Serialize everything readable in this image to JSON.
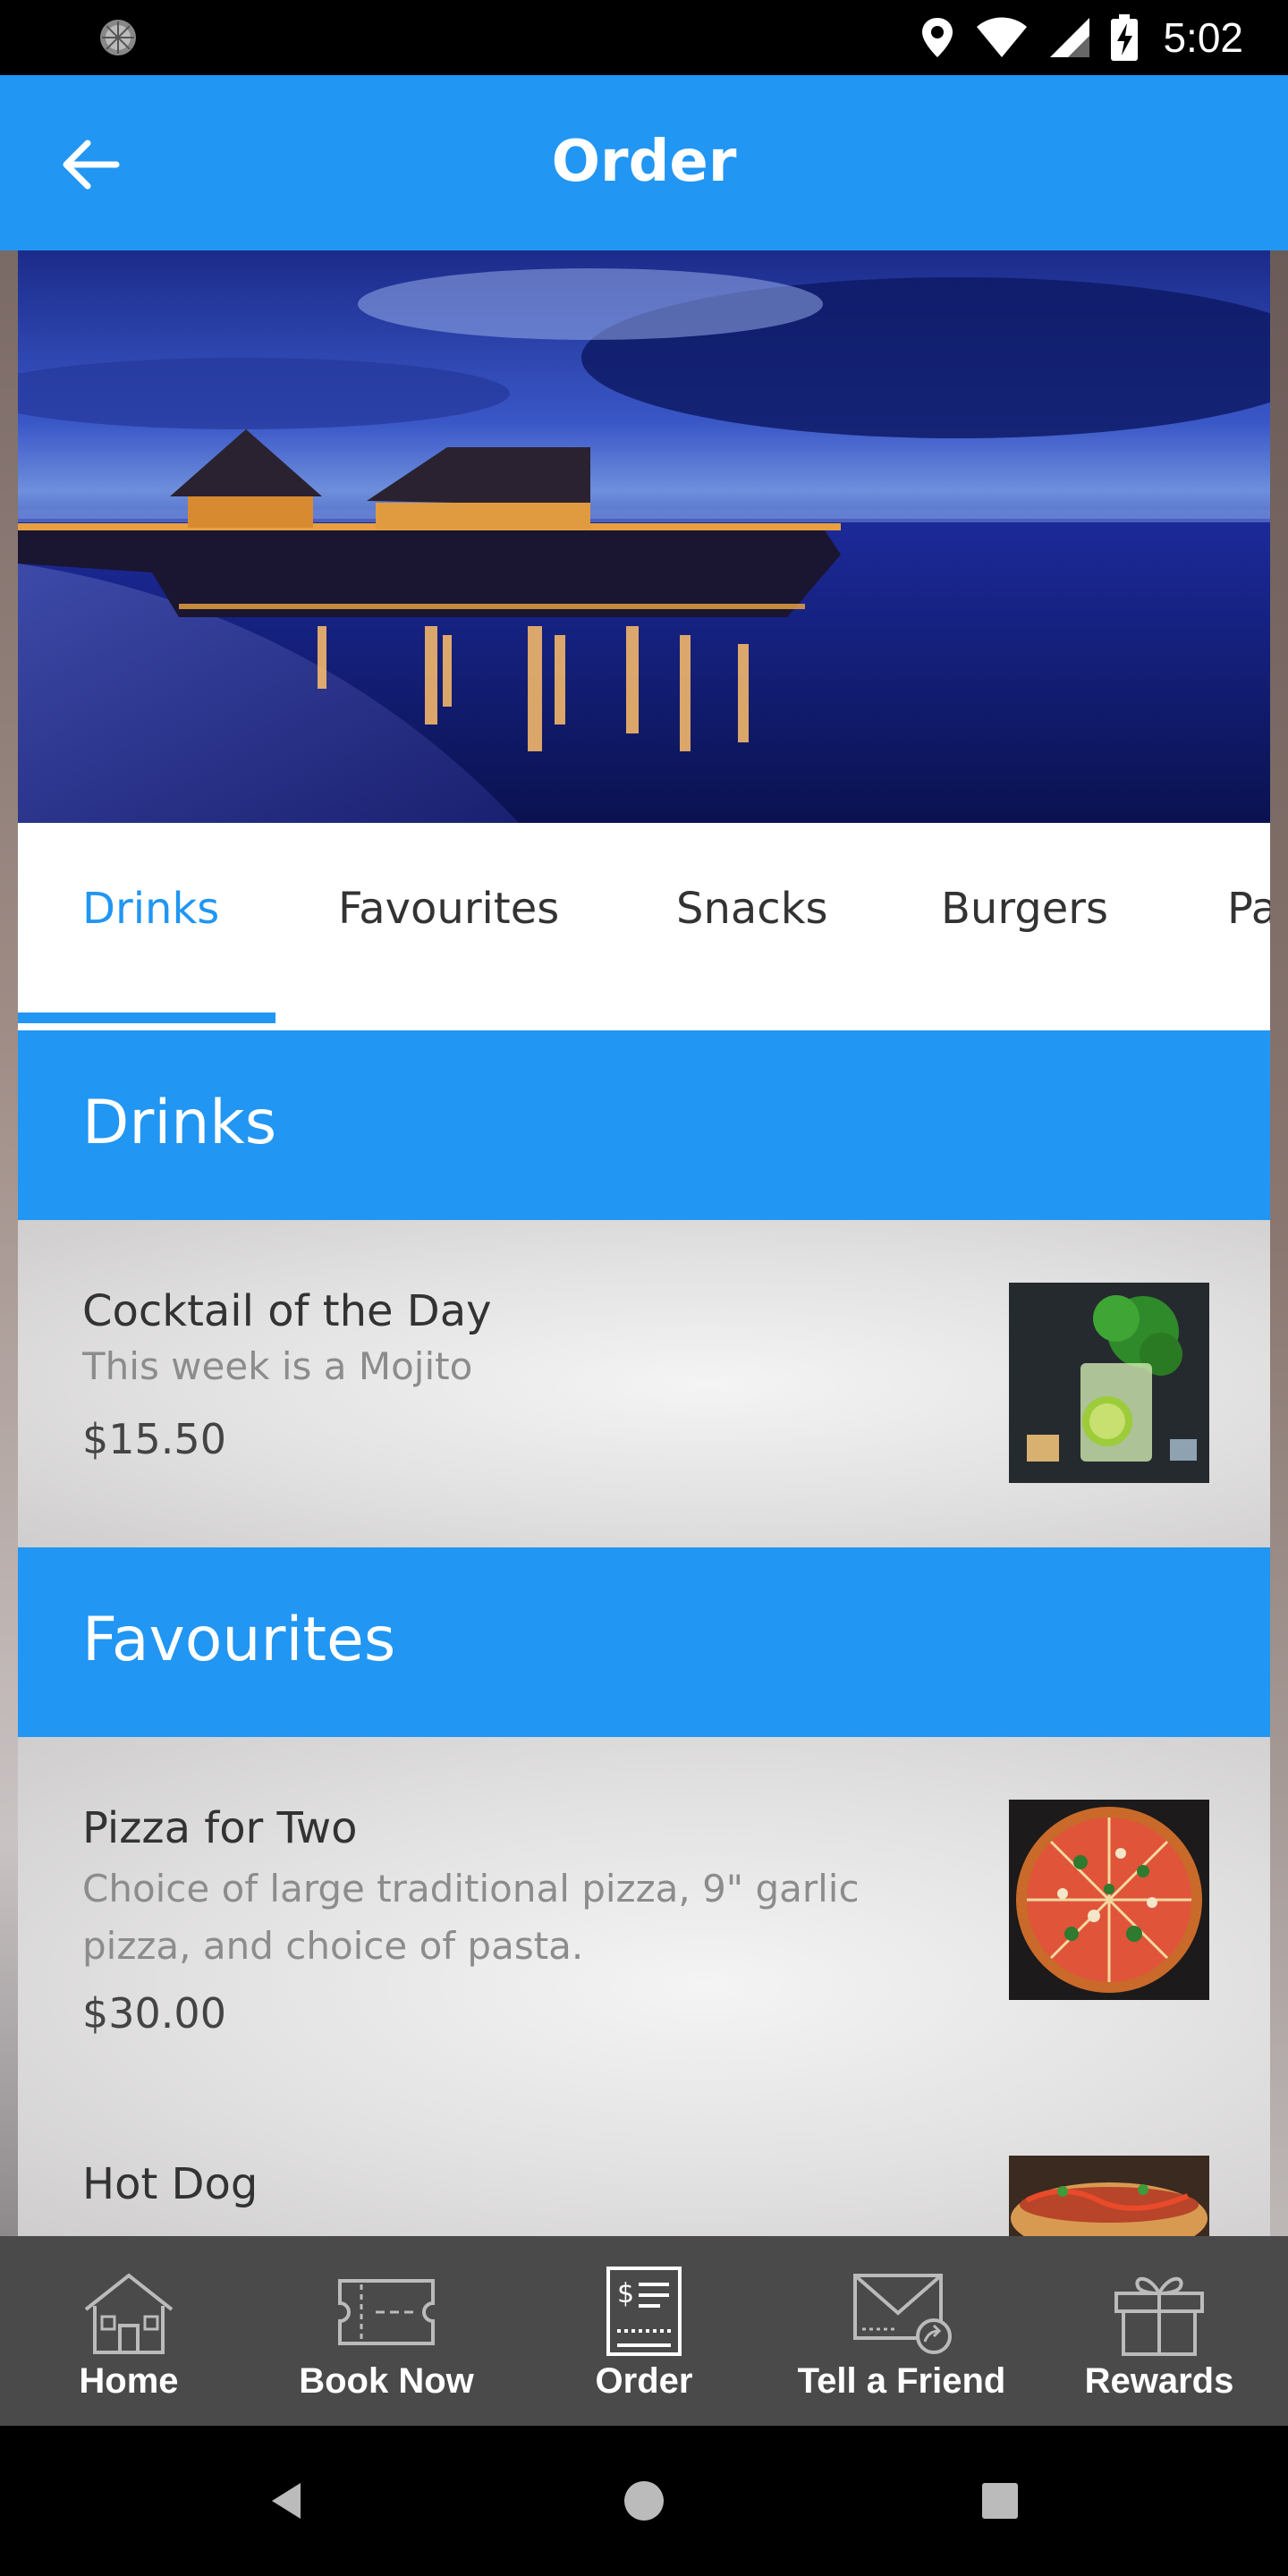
{
  "status_bar": {
    "time": "5:02"
  },
  "app_bar": {
    "title": "Order",
    "back_icon": "arrow-left-icon"
  },
  "tabs": [
    {
      "label": "Drinks",
      "active": true
    },
    {
      "label": "Favourites",
      "active": false
    },
    {
      "label": "Snacks",
      "active": false
    },
    {
      "label": "Burgers",
      "active": false
    },
    {
      "label": "Pa",
      "active": false
    }
  ],
  "sections": [
    {
      "title": "Drinks",
      "items": [
        {
          "name": "Cocktail of the Day",
          "description": "This week is a Mojito",
          "price": "$15.50",
          "image": "mojito-photo"
        }
      ]
    },
    {
      "title": "Favourites",
      "items": [
        {
          "name": "Pizza for Two",
          "description": "Choice of large traditional pizza, 9\" garlic pizza, and choice of pasta.",
          "price": "$30.00",
          "image": "pizza-photo"
        },
        {
          "name": "Hot Dog",
          "description": "",
          "price": "",
          "image": "hot-dog-photo"
        }
      ]
    }
  ],
  "bottom_nav": [
    {
      "label": "Home",
      "icon": "house-icon"
    },
    {
      "label": "Book Now",
      "icon": "ticket-icon"
    },
    {
      "label": "Order",
      "icon": "receipt-icon",
      "active": true
    },
    {
      "label": "Tell a Friend",
      "icon": "envelope-share-icon"
    },
    {
      "label": "Rewards",
      "icon": "gift-icon"
    }
  ],
  "colors": {
    "primary": "#2196f3",
    "nav_background": "#4a4a4a",
    "status_bar": "#000000"
  }
}
